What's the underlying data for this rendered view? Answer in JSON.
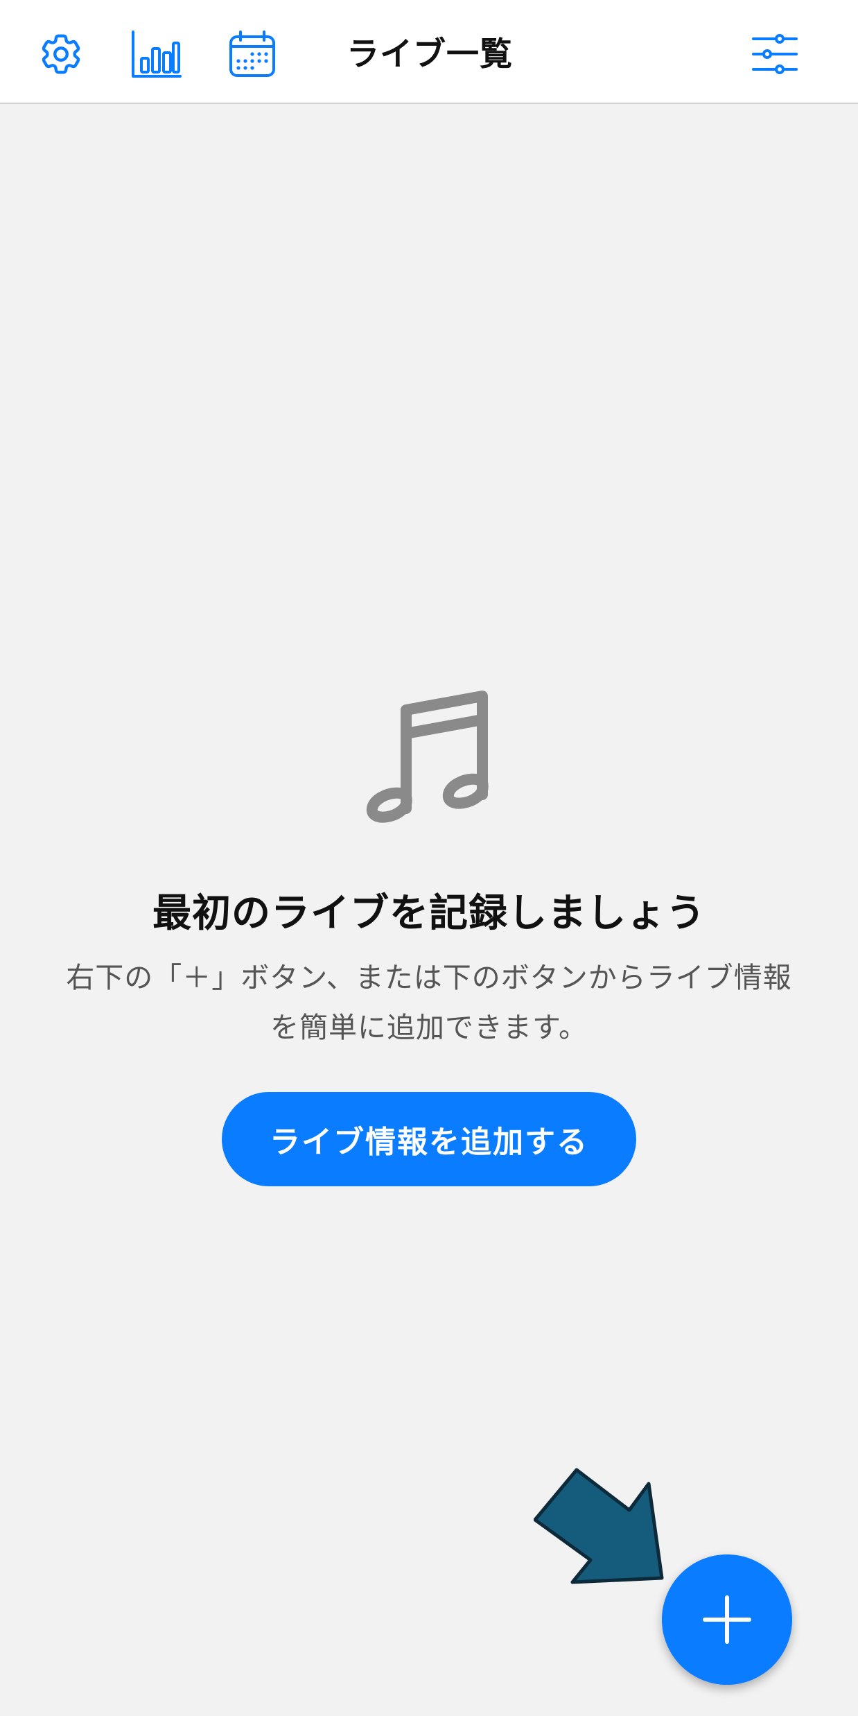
{
  "header": {
    "title": "ライブ一覧",
    "left_icons": [
      "gear-icon",
      "bar-chart-icon",
      "calendar-icon"
    ],
    "right_icon": "filter-sliders-icon"
  },
  "empty_state": {
    "icon": "music-note-icon",
    "title": "最初のライブを記録しましょう",
    "description_line1": "右下の「＋」ボタン、または下のボタンからライブ情報",
    "description_line2": "を簡単に追加できます。",
    "button_label": "ライブ情報を追加する"
  },
  "fab": {
    "icon": "plus-icon"
  },
  "colors": {
    "accent": "#0a7cff",
    "background": "#f2f2f2",
    "header_bg": "#ffffff",
    "icon_gray": "#8a8a8a",
    "arrow": "#155b7c"
  }
}
